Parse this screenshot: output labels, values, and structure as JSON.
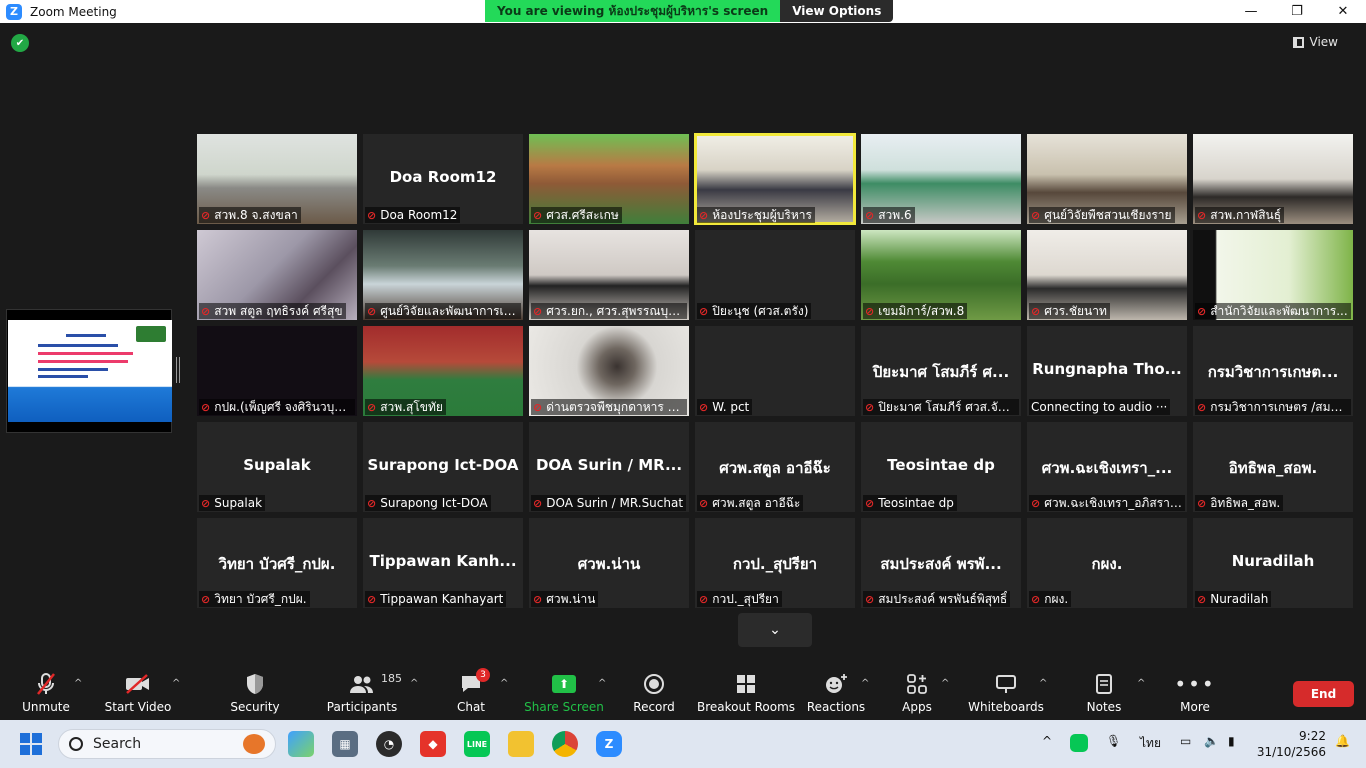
{
  "window": {
    "app_icon": "Z",
    "title": "Zoom Meeting",
    "controls": [
      "minimize-icon",
      "maximize-icon",
      "close-icon"
    ]
  },
  "banner": {
    "message": "You are viewing ห้องประชุมผู้บริหาร's screen",
    "options_label": "View Options"
  },
  "view_label": "View",
  "colors": {
    "active_speaker_border": "#f2e93b",
    "banner_green": "#23d959",
    "end_red": "#d62b2b",
    "muted_red": "#e02828"
  },
  "tiles": [
    {
      "big": "",
      "tag": "สวพ.8 จ.สงขลา",
      "video": true,
      "bg": "linear-gradient(180deg,#dfe3e0 0%,#cfd6cc 45%,#8a8a86 60%,#6b5a48 100%)"
    },
    {
      "big": "Doa Room12",
      "tag": "Doa Room12",
      "video": false
    },
    {
      "big": "",
      "tag": "ศวส.ศรีสะเกษ",
      "video": true,
      "bg": "linear-gradient(180deg,#6fbf54 0%,#b87a45 35%,#8f5a37 55%,#3f7f3a 100%)"
    },
    {
      "big": "",
      "tag": "ห้องประชุมผู้บริหาร",
      "video": true,
      "active": true,
      "bg": "linear-gradient(180deg,#f1efe7 0%,#d8d3c6 40%,#3a3a44 62%,#b9b2a5 100%)"
    },
    {
      "big": "",
      "tag": "สวพ.6",
      "video": true,
      "bg": "linear-gradient(180deg,#e8eef2 0%,#cfe0dc 40%,#3d8c64 55%,#c9c9c7 100%)"
    },
    {
      "big": "",
      "tag": "ศูนย์วิจัยพืชสวนเชียงราย",
      "video": true,
      "bg": "linear-gradient(180deg,#e6e2d8 0%,#c9c1ae 45%,#57483b 65%,#a79f91 100%)"
    },
    {
      "big": "",
      "tag": "สวพ.กาฬสินธุ์",
      "video": true,
      "bg": "linear-gradient(180deg,#f2f2ef 0%,#d8d4cc 50%,#2d2a28 70%,#9c8f80 100%)"
    },
    {
      "big": "",
      "tag": "สวพ สตูล ฤทธิรงค์ ศรีสุข",
      "video": true,
      "bg": "linear-gradient(135deg,#cfc9d4 0%,#9d98a8 45%,#5b4f5e 70%,#b8b0be 100%)"
    },
    {
      "big": "",
      "tag": "ศูนย์วิจัยและพัฒนาการเก...",
      "video": true,
      "bg": "linear-gradient(180deg,#303a38 0%,#6a7c73 40%,#c9d4d8 60%,#4a3a30 100%)"
    },
    {
      "big": "",
      "tag": "ศวร.ยก., ศวร.สุพรรณบุรี,...",
      "video": true,
      "bg": "linear-gradient(180deg,#e7e3e0 0%,#cfc9c4 50%,#222222 62%,#d0cac4 100%)"
    },
    {
      "big": "",
      "tag": "ปิยะนุช (ศวส.ตรัง)",
      "video": false
    },
    {
      "big": "",
      "tag": "เขมมิการ์/สวพ.8",
      "video": true,
      "bg": "linear-gradient(180deg,#cde6c1 0%,#4f8a35 35%,#3b6d28 60%,#6f9a45 100%)"
    },
    {
      "big": "",
      "tag": "ศวร.ชัยนาท",
      "video": true,
      "bg": "linear-gradient(180deg,#f0ede8 0%,#ddd8d0 50%,#2b2b2b 65%,#bdb6ac 100%)"
    },
    {
      "big": "",
      "tag": "สำนักวิจัยและพัฒนาการ...",
      "video": true,
      "bg": "linear-gradient(90deg,#101010 0%,#101010 14%,#f2f6ea 15%,#e3efd2 60%,#7fb449 100%)"
    },
    {
      "big": "",
      "tag": "กปผ.(เพ็ญศรี จงศิรินวบุตร)",
      "video": true,
      "bg": "#120d14"
    },
    {
      "big": "",
      "tag": "สวพ.สุโขทัย",
      "video": true,
      "bg": "linear-gradient(180deg,#a22c2c 0%,#b64a3a 40%,#2f7d3f 60%,#2b7b3a 100%)"
    },
    {
      "big": "",
      "tag": "ด่านตรวจพืชมุกดาหาร (ป...",
      "video": true,
      "bg": "radial-gradient(circle at 55% 45%,#3a3330 0%,#6f6760 18%,#d8d6d2 40%,#eceae6 100%)"
    },
    {
      "big": "",
      "tag": "W. pct",
      "video": false
    },
    {
      "big": "ปิยะมาศ โสมภีร์ ศ...",
      "tag": "ปิยะมาศ โสมภีร์ ศวส.จันท...",
      "video": false
    },
    {
      "big": "Rungnapha  Tho...",
      "tag": "Connecting to audio ···",
      "video": false,
      "no_mic": true
    },
    {
      "big": "กรมวิชาการเกษต...",
      "tag": "กรมวิชาการเกษตร /สมคิ...",
      "video": false
    },
    {
      "big": "Supalak",
      "tag": "Supalak",
      "video": false
    },
    {
      "big": "Surapong Ict-DOA",
      "tag": "Surapong Ict-DOA",
      "video": false
    },
    {
      "big": "DOA Surin / MR...",
      "tag": "DOA Surin / MR.Suchat",
      "video": false
    },
    {
      "big": "ศวพ.สตูล อาอีฉ๊ะ",
      "tag": "ศวพ.สตูล อาอีฉ๊ะ",
      "video": false
    },
    {
      "big": "Teosintae dp",
      "tag": "Teosintae dp",
      "video": false
    },
    {
      "big": "ศวพ.ฉะเชิงเทรา_...",
      "tag": "ศวพ.ฉะเชิงเทรา_อภิสรา เ...",
      "video": false
    },
    {
      "big": "อิทธิพล_สอพ.",
      "tag": "อิทธิพล_สอพ.",
      "video": false
    },
    {
      "big": "วิทยา บัวศรี_กปผ.",
      "tag": "วิทยา บัวศรี_กปผ.",
      "video": false
    },
    {
      "big": "Tippawan  Kanh...",
      "tag": "Tippawan Kanhayart",
      "video": false
    },
    {
      "big": "ศวพ.น่าน",
      "tag": "ศวพ.น่าน",
      "video": false
    },
    {
      "big": "กวป._สุปรียา",
      "tag": "กวป._สุปรียา",
      "video": false
    },
    {
      "big": "สมประสงค์ พรพั...",
      "tag": "สมประสงค์ พรพันธ์พิสุทธิ์",
      "video": false
    },
    {
      "big": "กผง.",
      "tag": "กผง.",
      "video": false
    },
    {
      "big": "Nuradilah",
      "tag": "Nuradilah",
      "video": false
    }
  ],
  "toolbar": {
    "unmute": "Unmute",
    "start_video": "Start Video",
    "security": "Security",
    "participants": "Participants",
    "participants_count": "185",
    "chat": "Chat",
    "chat_badge": "3",
    "share_screen": "Share Screen",
    "record": "Record",
    "breakout_rooms": "Breakout Rooms",
    "reactions": "Reactions",
    "apps": "Apps",
    "whiteboards": "Whiteboards",
    "notes": "Notes",
    "more": "More",
    "end": "End"
  },
  "taskbar": {
    "search_placeholder": "Search",
    "tray_lang": "ไทย",
    "time": "9:22",
    "date": "31/10/2566"
  }
}
